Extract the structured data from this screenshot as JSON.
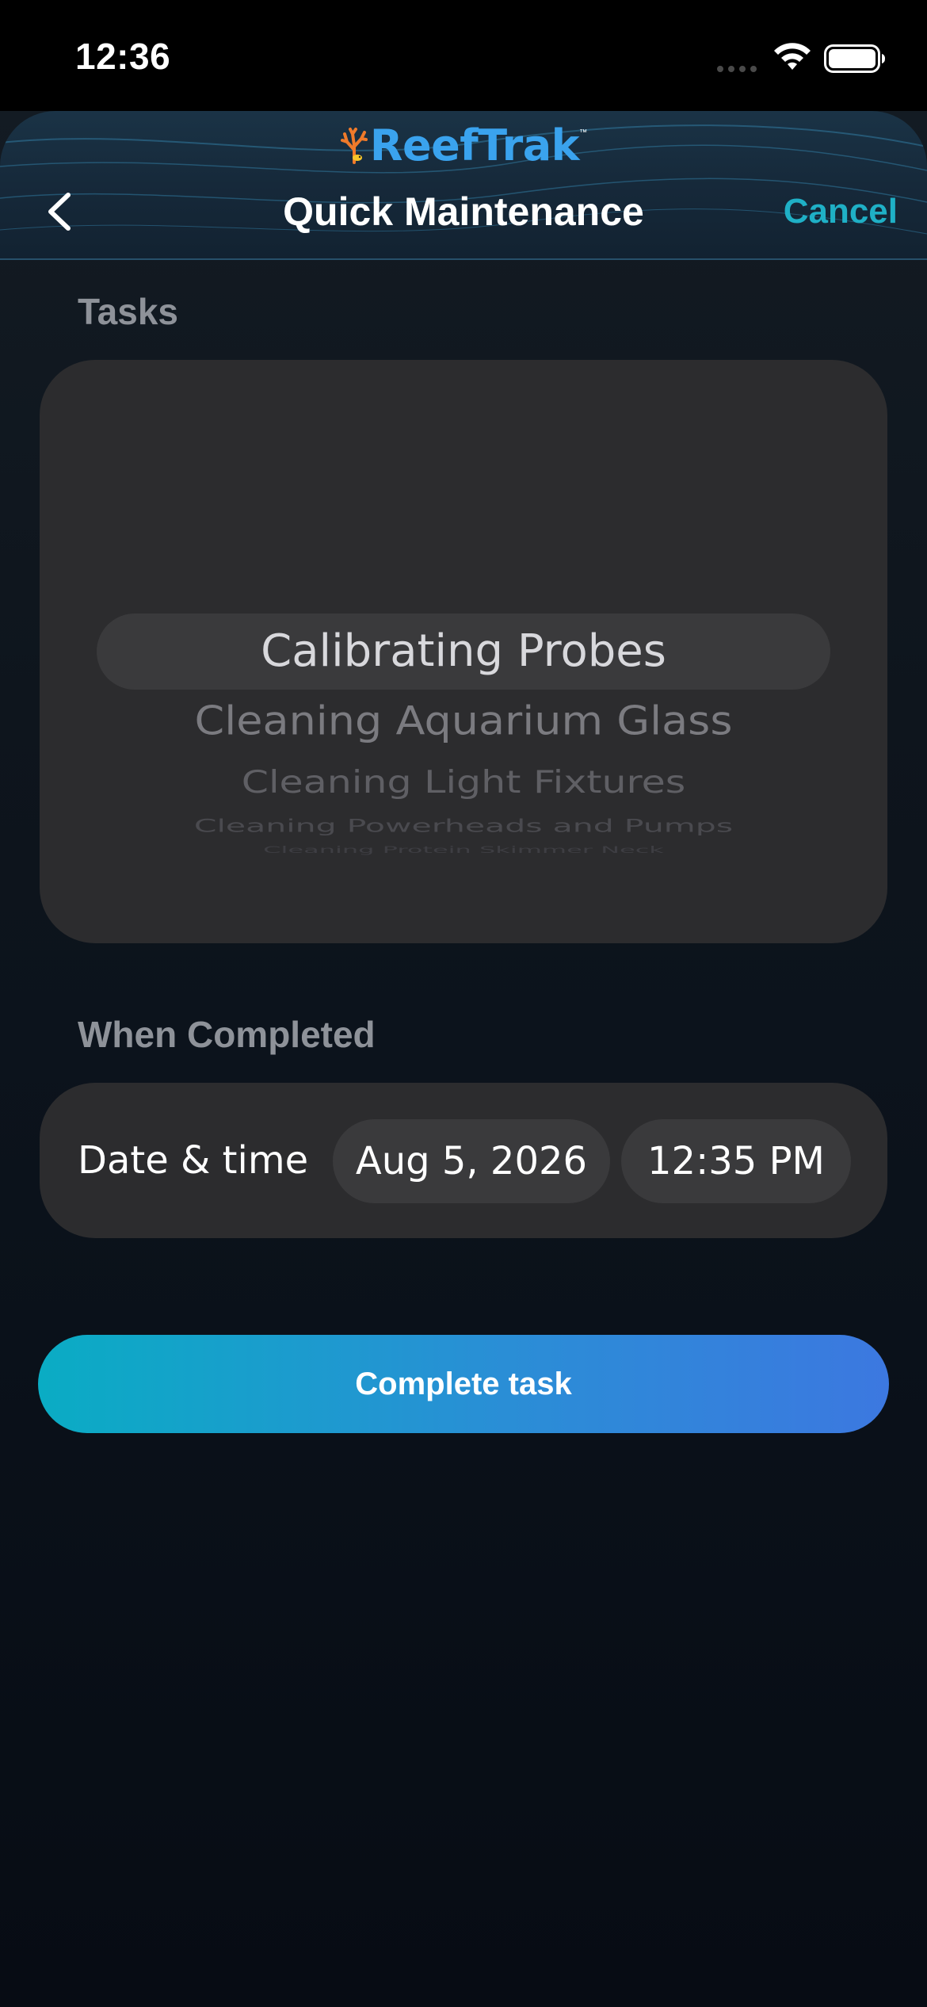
{
  "status_bar": {
    "time": "12:36"
  },
  "header": {
    "logo_text": "ReefTrak",
    "logo_tm": "™",
    "title": "Quick Maintenance",
    "cancel_label": "Cancel",
    "accent_color": "#1fb0c6"
  },
  "tasks": {
    "label": "Tasks",
    "picker_items": [
      "Calibrating Probes",
      "Cleaning Aquarium Glass",
      "Cleaning Light Fixtures",
      "Cleaning Powerheads and Pumps",
      "Cleaning Protein Skimmer Neck"
    ],
    "selected": "Calibrating Probes"
  },
  "when_completed": {
    "label": "When Completed",
    "datetime_label": "Date & time",
    "date": "Aug 5, 2026",
    "time": "12:35 PM"
  },
  "complete_button": {
    "label": "Complete task"
  },
  "icons": [
    "signal-icon",
    "wifi-icon",
    "battery-icon",
    "coral-logo-icon",
    "back-chevron-icon"
  ]
}
